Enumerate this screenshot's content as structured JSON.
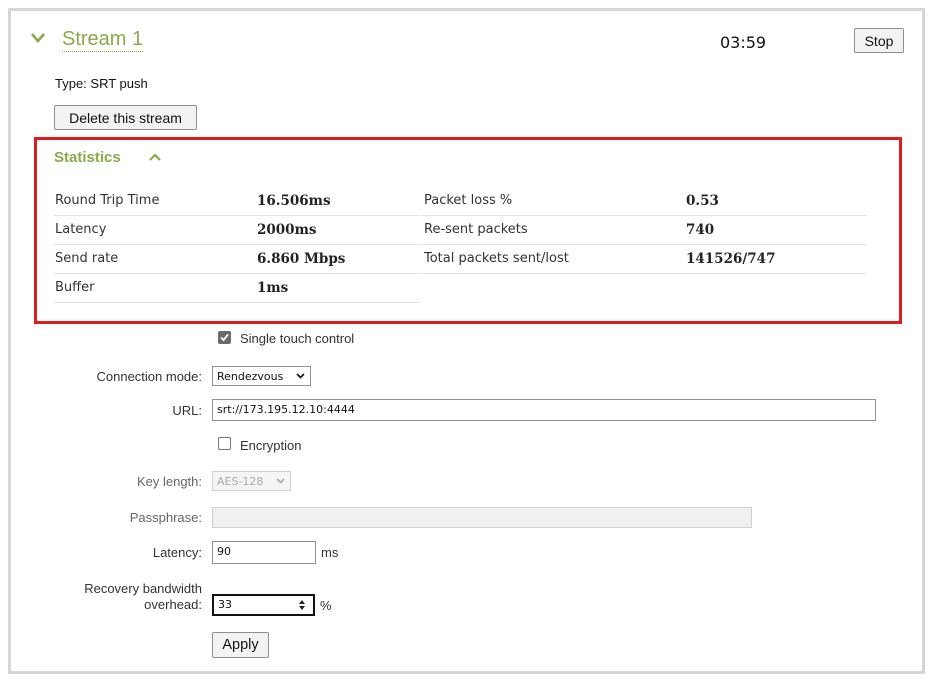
{
  "stream": {
    "title": "Stream 1",
    "timer": "03:59",
    "stop_label": "Stop",
    "type_label": "Type: SRT push",
    "delete_label": "Delete this stream"
  },
  "statistics": {
    "title": "Statistics",
    "rows_left": [
      {
        "label": "Round Trip Time",
        "value": "16.506ms"
      },
      {
        "label": "Latency",
        "value": "2000ms"
      },
      {
        "label": "Send rate",
        "value": "6.860 Mbps"
      },
      {
        "label": "Buffer",
        "value": "1ms"
      }
    ],
    "rows_right": [
      {
        "label": "Packet loss %",
        "value": "0.53"
      },
      {
        "label": "Re-sent packets",
        "value": "740"
      },
      {
        "label": "Total packets sent/lost",
        "value": "141526/747"
      }
    ]
  },
  "form": {
    "single_touch_label": "Single touch control",
    "single_touch_checked": true,
    "connection_mode_label": "Connection mode:",
    "connection_mode_value": "Rendezvous",
    "url_label": "URL:",
    "url_value": "srt://173.195.12.10:4444",
    "encryption_label": "Encryption",
    "encryption_checked": false,
    "key_length_label": "Key length:",
    "key_length_value": "AES-128",
    "passphrase_label": "Passphrase:",
    "passphrase_value": "",
    "latency_label": "Latency:",
    "latency_value": "90",
    "latency_unit": "ms",
    "recovery_label_line1": "Recovery bandwidth",
    "recovery_label_line2": "overhead:",
    "recovery_value": "33",
    "recovery_unit": "%",
    "apply_label": "Apply"
  },
  "colors": {
    "accent_green": "#8aaa4a",
    "highlight_red": "#e01b1b"
  }
}
